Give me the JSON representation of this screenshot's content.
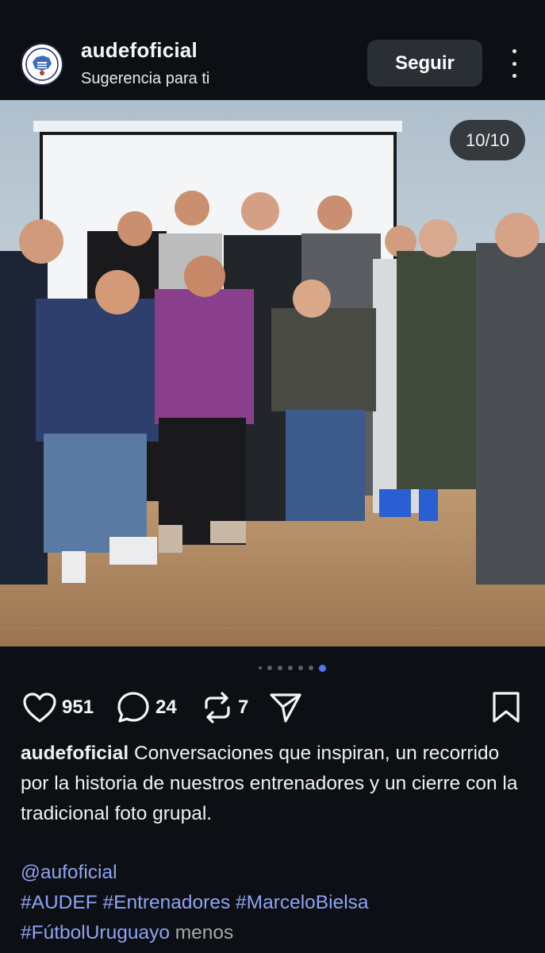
{
  "header": {
    "username": "audefoficial",
    "subtitle": "Sugerencia para ti",
    "follow_label": "Seguir",
    "avatar_icon": "audef-logo-icon",
    "more_icon": "more-vertical-icon"
  },
  "carousel": {
    "counter": "10/10",
    "total_dots": 7,
    "active_dot": 7
  },
  "actions": {
    "likes": "951",
    "comments": "24",
    "reposts": "7",
    "like_icon": "heart-icon",
    "comment_icon": "comment-icon",
    "repost_icon": "repost-icon",
    "share_icon": "send-icon",
    "save_icon": "bookmark-icon"
  },
  "caption": {
    "username": "audefoficial",
    "text": "Conversaciones que inspiran, un recorrido por la historia de nuestros entrenadores y un cierre con la tradicional foto grupal.",
    "mention": "@aufoficial",
    "hashtags": [
      "#AUDEF",
      "#Entrenadores",
      "#MarceloBielsa",
      "#FútbolUruguayo"
    ],
    "less_label": "menos"
  },
  "colors": {
    "background": "#0c1014",
    "accent_link": "#8fa3f5",
    "active_dot": "#5b75f0"
  }
}
